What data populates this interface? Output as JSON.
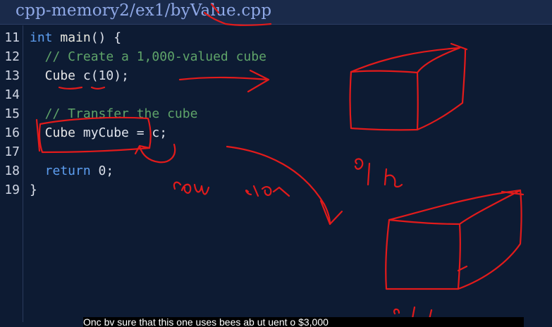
{
  "window": {
    "title": "cpp-memory2/ex1/byValue.cpp"
  },
  "editor": {
    "line_numbers": [
      "11",
      "12",
      "13",
      "14",
      "15",
      "16",
      "17",
      "18",
      "19"
    ],
    "lines": [
      [
        {
          "c": "kw",
          "t": "int"
        },
        {
          "c": "pun",
          "t": " "
        },
        {
          "c": "fn",
          "t": "main"
        },
        {
          "c": "pun",
          "t": "() {"
        }
      ],
      [
        {
          "c": "cm",
          "t": "  // Create a 1,000-valued cube"
        }
      ],
      [
        {
          "c": "ty",
          "t": "  Cube"
        },
        {
          "c": "pun",
          "t": " c("
        },
        {
          "c": "num",
          "t": "10"
        },
        {
          "c": "pun",
          "t": ");"
        }
      ],
      [],
      [
        {
          "c": "cm",
          "t": "  // Transfer the cube"
        }
      ],
      [
        {
          "c": "ty",
          "t": "  Cube"
        },
        {
          "c": "pun",
          "t": " myCube = c;"
        }
      ],
      [],
      [
        {
          "c": "kw",
          "t": "  return"
        },
        {
          "c": "pun",
          "t": " "
        },
        {
          "c": "num",
          "t": "0"
        },
        {
          "c": "pun",
          "t": ";"
        }
      ],
      [
        {
          "c": "pun",
          "t": "}"
        }
      ]
    ]
  },
  "annotations": {
    "copy_label": "Copy",
    "ctor_label": "ctor",
    "bytes_label": "8 | h",
    "ink_color": "#e21b1b"
  },
  "caption": {
    "text": "Onc bv sure that this one uses bees ab ut uent o $3,000"
  }
}
